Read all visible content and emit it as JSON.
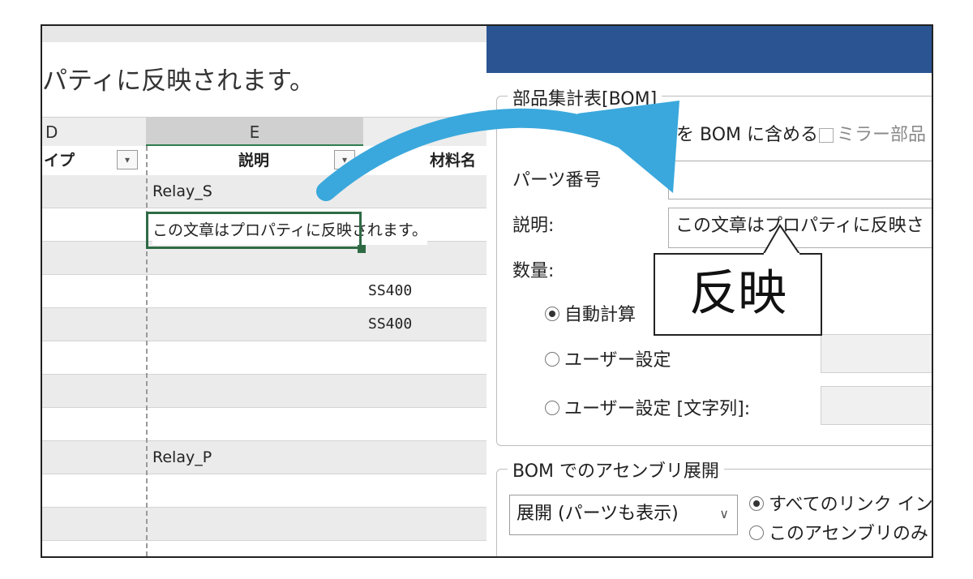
{
  "sheet": {
    "formula_text": "パティに反映されます。",
    "columns": {
      "d": "D",
      "e": "E"
    },
    "headers": {
      "type_partial": "イプ",
      "description": "説明",
      "material": "材料名"
    },
    "rows": [
      {
        "desc": "Relay_S",
        "material": ""
      },
      {
        "desc": "この文章はプロパティに反映されます。",
        "material": ""
      },
      {
        "desc": "",
        "material": ""
      },
      {
        "desc": "",
        "material": "SS400"
      },
      {
        "desc": "",
        "material": "SS400"
      },
      {
        "desc": "",
        "material": ""
      },
      {
        "desc": "",
        "material": ""
      },
      {
        "desc": "",
        "material": ""
      },
      {
        "desc": "Relay_P",
        "material": ""
      },
      {
        "desc": "",
        "material": ""
      },
      {
        "desc": "",
        "material": ""
      }
    ],
    "active_cell_text": "この文章はプロパティに反映されます。",
    "filter_icon": "▾"
  },
  "dialog": {
    "bom_group": {
      "legend": "部品集計表[BOM]",
      "include_label": "を BOM に含める",
      "mirror_label": "ミラー部品",
      "part_number_label": "パーツ番号",
      "description_label": "説明:",
      "description_value": "この文章はプロパティに反映さ",
      "quantity_label": "数量:",
      "auto_calc": "自動計算",
      "user_setting": "ユーザー設定",
      "user_setting_string": "ユーザー設定 [文字列]:"
    },
    "assembly_group": {
      "legend": "BOM でのアセンブリ展開",
      "select_value": "展開 (パーツも表示)",
      "all_links": "すべてのリンク イン",
      "assembly_only": "このアセンブリのみ"
    }
  },
  "callout": {
    "text": "反映"
  },
  "colors": {
    "titlebar": "#2b5493",
    "arrow": "#3aa8dc",
    "active_cell_border": "#2e6b45"
  }
}
